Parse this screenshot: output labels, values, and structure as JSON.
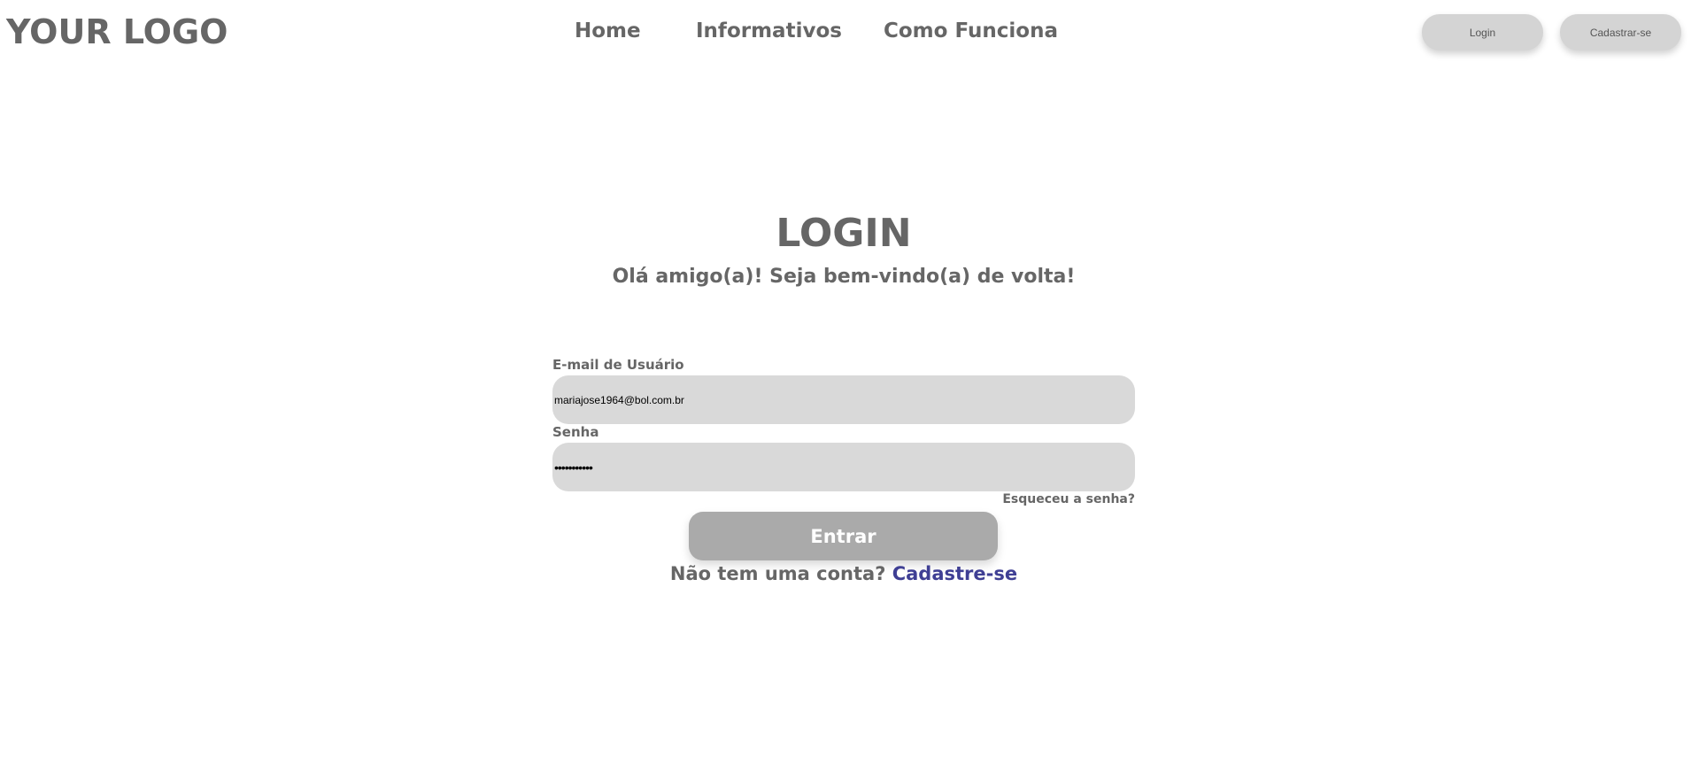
{
  "header": {
    "logo": "YOUR LOGO",
    "nav": [
      {
        "label": "Home"
      },
      {
        "label": "Informativos"
      },
      {
        "label": "Como Funciona"
      }
    ],
    "login_button": "Login",
    "signup_button": "Cadastrar-se"
  },
  "main": {
    "title": "LOGIN",
    "subtitle": "Olá amigo(a)! Seja bem-vindo(a) de volta!",
    "email_label": "E-mail de Usuário",
    "email_value": "mariajose1964@bol.com.br",
    "password_label": "Senha",
    "password_value": "•••••••••••",
    "forgot_link": "Esqueceu a senha?",
    "submit_button": "Entrar",
    "no_account_text": "Não tem uma conta?",
    "signup_link": "Cadastre-se"
  },
  "colors": {
    "text_gray": "#666666",
    "field_bg": "#d9d9d9",
    "button_bg": "#aaaaaa",
    "header_button_bg": "#d4d4d4",
    "link_blue": "#3f3f94"
  }
}
